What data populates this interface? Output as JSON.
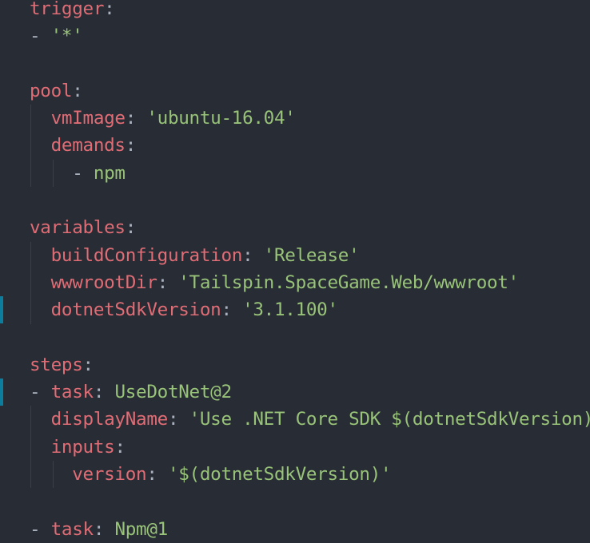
{
  "editor": {
    "language": "yaml",
    "accent_colors": {
      "key": "#e06c75",
      "string": "#98c379",
      "punct": "#abb2bf",
      "modified_marker": "#0c7d9d"
    },
    "lines": [
      {
        "indent": 0,
        "tokens": [
          {
            "t": "key",
            "v": "trigger"
          },
          {
            "t": "punct",
            "v": ":"
          }
        ]
      },
      {
        "indent": 0,
        "tokens": [
          {
            "t": "dash",
            "v": "- "
          },
          {
            "t": "str",
            "v": "'*'"
          }
        ]
      },
      {
        "indent": 0,
        "tokens": []
      },
      {
        "indent": 0,
        "tokens": [
          {
            "t": "key",
            "v": "pool"
          },
          {
            "t": "punct",
            "v": ":"
          }
        ]
      },
      {
        "indent": 2,
        "guides": [
          1
        ],
        "tokens": [
          {
            "t": "key",
            "v": "vmImage"
          },
          {
            "t": "punct",
            "v": ": "
          },
          {
            "t": "str",
            "v": "'ubuntu-16.04'"
          }
        ]
      },
      {
        "indent": 2,
        "guides": [
          1
        ],
        "tokens": [
          {
            "t": "key",
            "v": "demands"
          },
          {
            "t": "punct",
            "v": ":"
          }
        ]
      },
      {
        "indent": 4,
        "guides": [
          1,
          3
        ],
        "tokens": [
          {
            "t": "dash",
            "v": "- "
          },
          {
            "t": "str",
            "v": "npm"
          }
        ]
      },
      {
        "indent": 0,
        "tokens": []
      },
      {
        "indent": 0,
        "tokens": [
          {
            "t": "key",
            "v": "variables"
          },
          {
            "t": "punct",
            "v": ":"
          }
        ]
      },
      {
        "indent": 2,
        "guides": [
          1
        ],
        "tokens": [
          {
            "t": "key",
            "v": "buildConfiguration"
          },
          {
            "t": "punct",
            "v": ": "
          },
          {
            "t": "str",
            "v": "'Release'"
          }
        ]
      },
      {
        "indent": 2,
        "guides": [
          1
        ],
        "tokens": [
          {
            "t": "key",
            "v": "wwwrootDir"
          },
          {
            "t": "punct",
            "v": ": "
          },
          {
            "t": "str",
            "v": "'Tailspin.SpaceGame.Web/wwwroot'"
          }
        ]
      },
      {
        "indent": 2,
        "guides": [
          1
        ],
        "modified": true,
        "tokens": [
          {
            "t": "key",
            "v": "dotnetSdkVersion"
          },
          {
            "t": "punct",
            "v": ": "
          },
          {
            "t": "str",
            "v": "'3.1.100'"
          }
        ]
      },
      {
        "indent": 0,
        "tokens": []
      },
      {
        "indent": 0,
        "tokens": [
          {
            "t": "key",
            "v": "steps"
          },
          {
            "t": "punct",
            "v": ":"
          }
        ]
      },
      {
        "indent": 0,
        "modified": true,
        "tokens": [
          {
            "t": "dash",
            "v": "- "
          },
          {
            "t": "key",
            "v": "task"
          },
          {
            "t": "punct",
            "v": ": "
          },
          {
            "t": "str",
            "v": "UseDotNet@2"
          }
        ]
      },
      {
        "indent": 2,
        "guides": [
          1
        ],
        "tokens": [
          {
            "t": "key",
            "v": "displayName"
          },
          {
            "t": "punct",
            "v": ": "
          },
          {
            "t": "str",
            "v": "'Use .NET Core SDK $(dotnetSdkVersion)'"
          }
        ]
      },
      {
        "indent": 2,
        "guides": [
          1
        ],
        "tokens": [
          {
            "t": "key",
            "v": "inputs"
          },
          {
            "t": "punct",
            "v": ":"
          }
        ]
      },
      {
        "indent": 4,
        "guides": [
          1,
          3
        ],
        "tokens": [
          {
            "t": "key",
            "v": "version"
          },
          {
            "t": "punct",
            "v": ": "
          },
          {
            "t": "str",
            "v": "'$(dotnetSdkVersion)'"
          }
        ]
      },
      {
        "indent": 0,
        "tokens": []
      },
      {
        "indent": 0,
        "tokens": [
          {
            "t": "dash",
            "v": "- "
          },
          {
            "t": "key",
            "v": "task"
          },
          {
            "t": "punct",
            "v": ": "
          },
          {
            "t": "str",
            "v": "Npm@1"
          }
        ]
      }
    ]
  }
}
